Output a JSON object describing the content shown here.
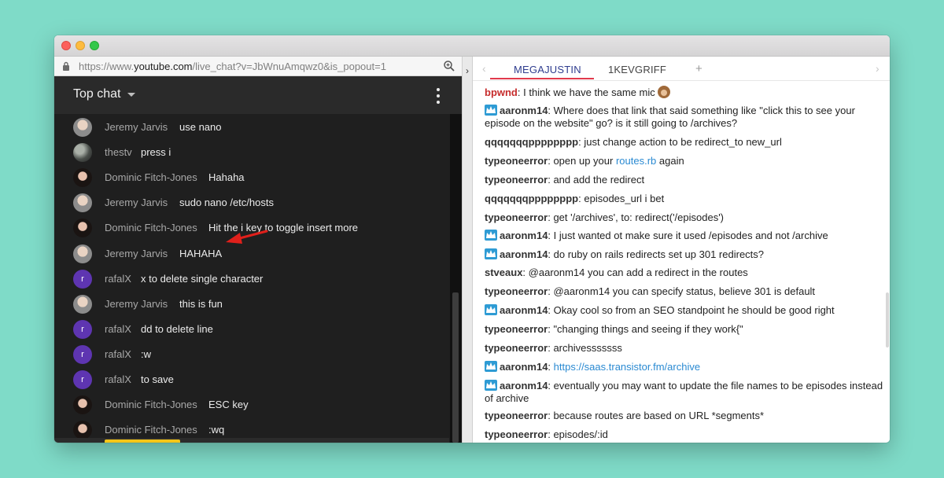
{
  "browser": {
    "url_prefix": "https://www.",
    "url_domain": "youtube.com",
    "url_path": "/live_chat?v=JbWnuAmqwz0&is_popout=1"
  },
  "left_chat": {
    "header_title": "Top chat",
    "messages": [
      {
        "author": "Jeremy Jarvis",
        "text": "use nano",
        "avatar": "jeremy"
      },
      {
        "author": "thestv",
        "text": "press i",
        "avatar": "thestv"
      },
      {
        "author": "Dominic Fitch-Jones",
        "text": "Hahaha",
        "avatar": "dominic"
      },
      {
        "author": "Jeremy Jarvis",
        "text": "sudo nano /etc/hosts",
        "avatar": "jeremy"
      },
      {
        "author": "Dominic Fitch-Jones",
        "text": "Hit the i key to toggle insert more",
        "avatar": "dominic"
      },
      {
        "author": "Jeremy Jarvis",
        "text": "HAHAHA",
        "avatar": "jeremy"
      },
      {
        "author": "rafalX",
        "text": "x to delete single character",
        "avatar": "rafal"
      },
      {
        "author": "Jeremy Jarvis",
        "text": "this is fun",
        "avatar": "jeremy"
      },
      {
        "author": "rafalX",
        "text": "dd to delete line",
        "avatar": "rafal"
      },
      {
        "author": "rafalX",
        "text": ":w",
        "avatar": "rafal"
      },
      {
        "author": "rafalX",
        "text": "to save",
        "avatar": "rafal"
      },
      {
        "author": "Dominic Fitch-Jones",
        "text": "ESC key",
        "avatar": "dominic"
      },
      {
        "author": "Dominic Fitch-Jones",
        "text": ":wq",
        "avatar": "dominic"
      }
    ],
    "rafal_initial": "r"
  },
  "right_chat": {
    "tabs": [
      {
        "label": "MEGAJUSTIN",
        "active": true
      },
      {
        "label": "1KEVGRIFF",
        "active": false
      }
    ],
    "add_tab": "+",
    "nav_left": "‹",
    "nav_right": "›",
    "divider_arrow": "›",
    "messages": [
      {
        "nick": "bpwnd",
        "red": true,
        "badge": false,
        "text": "I think we have the same mic",
        "emoji": true
      },
      {
        "nick": "aaronm14",
        "badge": true,
        "text": "Where does that link that said something like \"click this to see your episode on the website\" go? is it still going to /archives?"
      },
      {
        "nick": "qqqqqqqpppppppp",
        "badge": false,
        "text": "just change action to be redirect_to new_url"
      },
      {
        "nick": "typeoneerror",
        "badge": false,
        "text_before": "open up your ",
        "link": "routes.rb",
        "text_after": " again"
      },
      {
        "nick": "typeoneerror",
        "badge": false,
        "text": "and add the redirect"
      },
      {
        "nick": "qqqqqqqpppppppp",
        "badge": false,
        "text": "episodes_url i bet"
      },
      {
        "nick": "typeoneerror",
        "badge": false,
        "text": "get '/archives', to: redirect('/episodes')"
      },
      {
        "nick": "aaronm14",
        "badge": true,
        "text": "I just wanted ot make sure it used /episodes and not /archive"
      },
      {
        "nick": "aaronm14",
        "badge": true,
        "text": "do ruby on rails redirects set up 301 redirects?"
      },
      {
        "nick": "stveaux",
        "badge": false,
        "text": "@aaronm14 you can add a redirect in the routes"
      },
      {
        "nick": "typeoneerror",
        "badge": false,
        "text": "@aaronm14 you can specify status, believe 301 is default"
      },
      {
        "nick": "aaronm14",
        "badge": true,
        "text": "Okay cool so from an SEO standpoint he should be good right"
      },
      {
        "nick": "typeoneerror",
        "badge": false,
        "text": "\"changing things and seeing if they work{\""
      },
      {
        "nick": "typeoneerror",
        "badge": false,
        "text": "archivesssssss"
      },
      {
        "nick": "aaronm14",
        "badge": true,
        "text_before": "",
        "link": "https://saas.transistor.fm/archive",
        "text_after": ""
      },
      {
        "nick": "aaronm14",
        "badge": true,
        "text": "eventually you may want to update the file names to be episodes instead of archive"
      },
      {
        "nick": "typeoneerror",
        "badge": false,
        "text": "because routes are based on URL *segments*"
      },
      {
        "nick": "typeoneerror",
        "badge": false,
        "text": "episodes/:id"
      }
    ]
  },
  "colors": {
    "accent_tab": "#2f3d8f",
    "tab_underline": "#e23a4c",
    "link": "#2a8ad2",
    "badge": "#2e9bd4",
    "annotation_arrow": "#e0201b"
  }
}
